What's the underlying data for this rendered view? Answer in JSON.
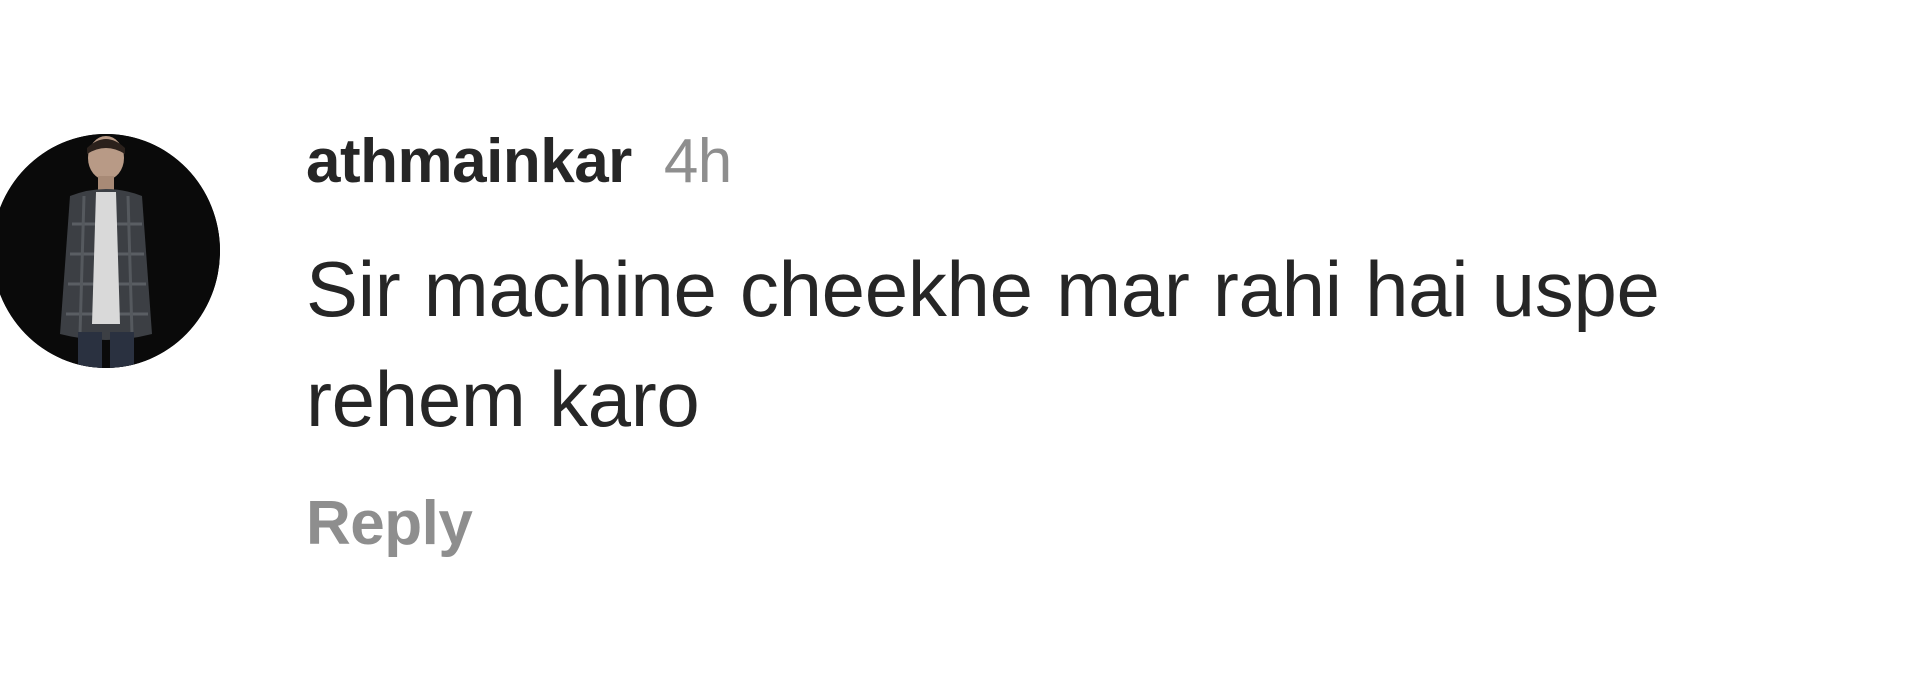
{
  "comment": {
    "avatar_icon": "user-avatar-photo",
    "username": "athmainkar",
    "time_ago": "4h",
    "text_lines": [
      "Sir machine cheekhe mar rahi hai uspe",
      "rehem karo"
    ],
    "reply_label": "Reply"
  },
  "colors": {
    "text_primary": "#262626",
    "text_secondary": "#8e8e8e",
    "background": "#ffffff",
    "avatar_bg": "#0a0a0a"
  }
}
